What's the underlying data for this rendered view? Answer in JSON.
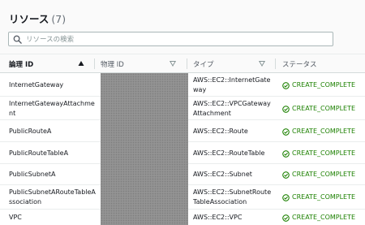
{
  "header": {
    "title": "リソース",
    "count": "(7)"
  },
  "search": {
    "placeholder": "リソースの検索"
  },
  "columns": {
    "logical_id": "論理 ID",
    "physical_id": "物理 ID",
    "type": "タイプ",
    "status": "ステータス"
  },
  "rows": [
    {
      "logical_id": "InternetGateway",
      "type": "AWS::EC2::InternetGateway",
      "status": "CREATE_COMPLETE"
    },
    {
      "logical_id": "InternetGatewayAttachment",
      "type": "AWS::EC2::VPCGatewayAttachment",
      "status": "CREATE_COMPLETE"
    },
    {
      "logical_id": "PublicRouteA",
      "type": "AWS::EC2::Route",
      "status": "CREATE_COMPLETE"
    },
    {
      "logical_id": "PublicRouteTableA",
      "type": "AWS::EC2::RouteTable",
      "status": "CREATE_COMPLETE"
    },
    {
      "logical_id": "PublicSubnetA",
      "type": "AWS::EC2::Subnet",
      "status": "CREATE_COMPLETE"
    },
    {
      "logical_id": "PublicSubnetARouteTableAssociation",
      "type": "AWS::EC2::SubnetRouteTableAssociation",
      "status": "CREATE_COMPLETE"
    },
    {
      "logical_id": "VPC",
      "type": "AWS::EC2::VPC",
      "status": "CREATE_COMPLETE"
    }
  ],
  "colors": {
    "success": "#1d8102",
    "header_bg": "#fafafa",
    "border": "#eaeded"
  }
}
